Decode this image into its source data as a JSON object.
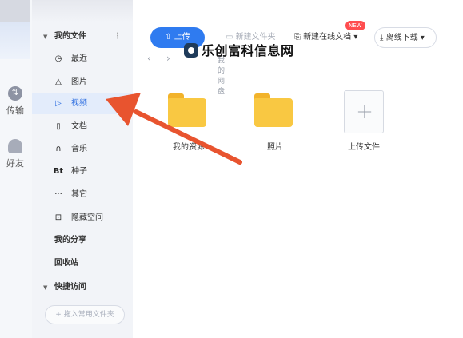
{
  "rail": {
    "transfer_label": "传输",
    "transfer_icon": "transfer-icon",
    "friends_label": "好友",
    "friends_icon": "friends-icon"
  },
  "sidebar": {
    "my_files": "我的文件",
    "items": [
      {
        "icon": "clock-icon",
        "glyph": "◷",
        "label": "最近"
      },
      {
        "icon": "image-icon",
        "glyph": "△",
        "label": "图片"
      },
      {
        "icon": "play-icon",
        "glyph": "▷",
        "label": "视频"
      },
      {
        "icon": "document-icon",
        "glyph": "▯",
        "label": "文档"
      },
      {
        "icon": "headphones-icon",
        "glyph": "∩",
        "label": "音乐"
      },
      {
        "icon": "bt-icon",
        "glyph": "Bt",
        "label": "种子"
      },
      {
        "icon": "more-icon",
        "glyph": "···",
        "label": "其它"
      },
      {
        "icon": "lock-icon",
        "glyph": "⊡",
        "label": "隐藏空间"
      }
    ],
    "my_share": "我的分享",
    "recycle_bin": "回收站",
    "quick_access": "快捷访问",
    "add_folder_placeholder": "+ 拖入常用文件夹"
  },
  "toolbar": {
    "upload": "上传",
    "new_folder": "新建文件夹",
    "new_doc": "新建在线文档",
    "new_badge": "NEW",
    "offline_download": "离线下载"
  },
  "breadcrumb": {
    "back": "‹",
    "forward": "›",
    "current": "我的网盘"
  },
  "files": [
    {
      "name": "我的资源",
      "type": "folder"
    },
    {
      "name": "照片",
      "type": "folder"
    },
    {
      "name": "上传文件",
      "type": "upload"
    }
  ],
  "watermark": "乐创富科信息网",
  "colors": {
    "accent": "#2f7bf0",
    "folder": "#f9c842",
    "arrow": "#e8542f"
  }
}
